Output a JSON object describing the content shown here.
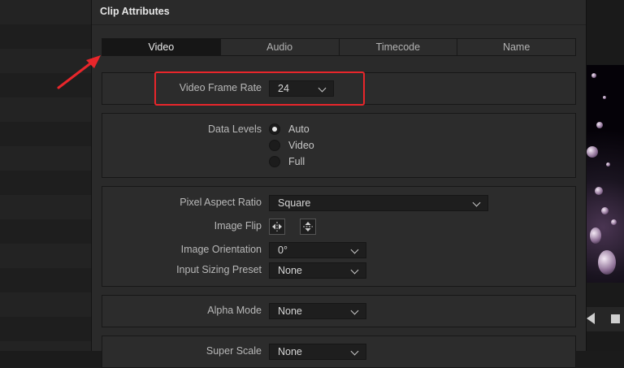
{
  "dialog": {
    "title": "Clip Attributes"
  },
  "tabs": [
    {
      "label": "Video",
      "active": true
    },
    {
      "label": "Audio",
      "active": false
    },
    {
      "label": "Timecode",
      "active": false
    },
    {
      "label": "Name",
      "active": false
    }
  ],
  "frame_rate": {
    "label": "Video Frame Rate",
    "value": "24"
  },
  "data_levels": {
    "label": "Data Levels",
    "options": [
      {
        "label": "Auto",
        "selected": true
      },
      {
        "label": "Video",
        "selected": false
      },
      {
        "label": "Full",
        "selected": false
      }
    ]
  },
  "pixel_aspect": {
    "label": "Pixel Aspect Ratio",
    "value": "Square"
  },
  "image_flip": {
    "label": "Image Flip",
    "horizontal_icon": "flip-horizontal-icon",
    "vertical_icon": "flip-vertical-icon"
  },
  "image_orientation": {
    "label": "Image Orientation",
    "value": "0°"
  },
  "input_sizing": {
    "label": "Input Sizing Preset",
    "value": "None"
  },
  "alpha_mode": {
    "label": "Alpha Mode",
    "value": "None"
  },
  "super_scale": {
    "label": "Super Scale",
    "value": "None"
  },
  "annotation": {
    "color": "#e8262b"
  }
}
